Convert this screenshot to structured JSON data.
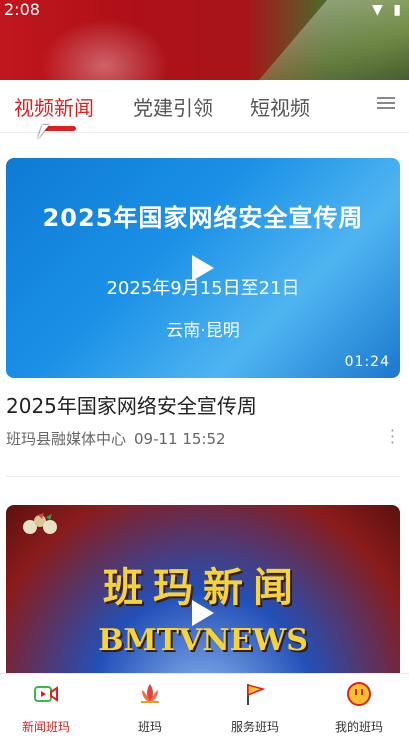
{
  "status": {
    "time": "2:08"
  },
  "tabs": [
    {
      "label": "视频新闻",
      "active": true
    },
    {
      "label": "党建引领",
      "active": false
    },
    {
      "label": "短视频",
      "active": false
    }
  ],
  "videos": [
    {
      "thumb_title": "2025年国家网络安全宣传周",
      "thumb_date": "2025年9月15日至21日",
      "thumb_location": "云南·昆明",
      "duration": "01:24",
      "title": "2025年国家网络安全宣传周",
      "source": "班玛县融媒体中心",
      "time": "09-11 15:52"
    },
    {
      "thumb_title": "班玛新闻",
      "thumb_subtitle": "BMTVNEWS"
    }
  ],
  "bottom_nav": [
    {
      "label": "新闻班玛",
      "icon": "video-icon",
      "active": true
    },
    {
      "label": "班玛",
      "icon": "lotus-icon",
      "active": false
    },
    {
      "label": "服务班玛",
      "icon": "flag-icon",
      "active": false
    },
    {
      "label": "我的班玛",
      "icon": "smiley-icon",
      "active": false
    }
  ],
  "colors": {
    "accent": "#e02020"
  }
}
